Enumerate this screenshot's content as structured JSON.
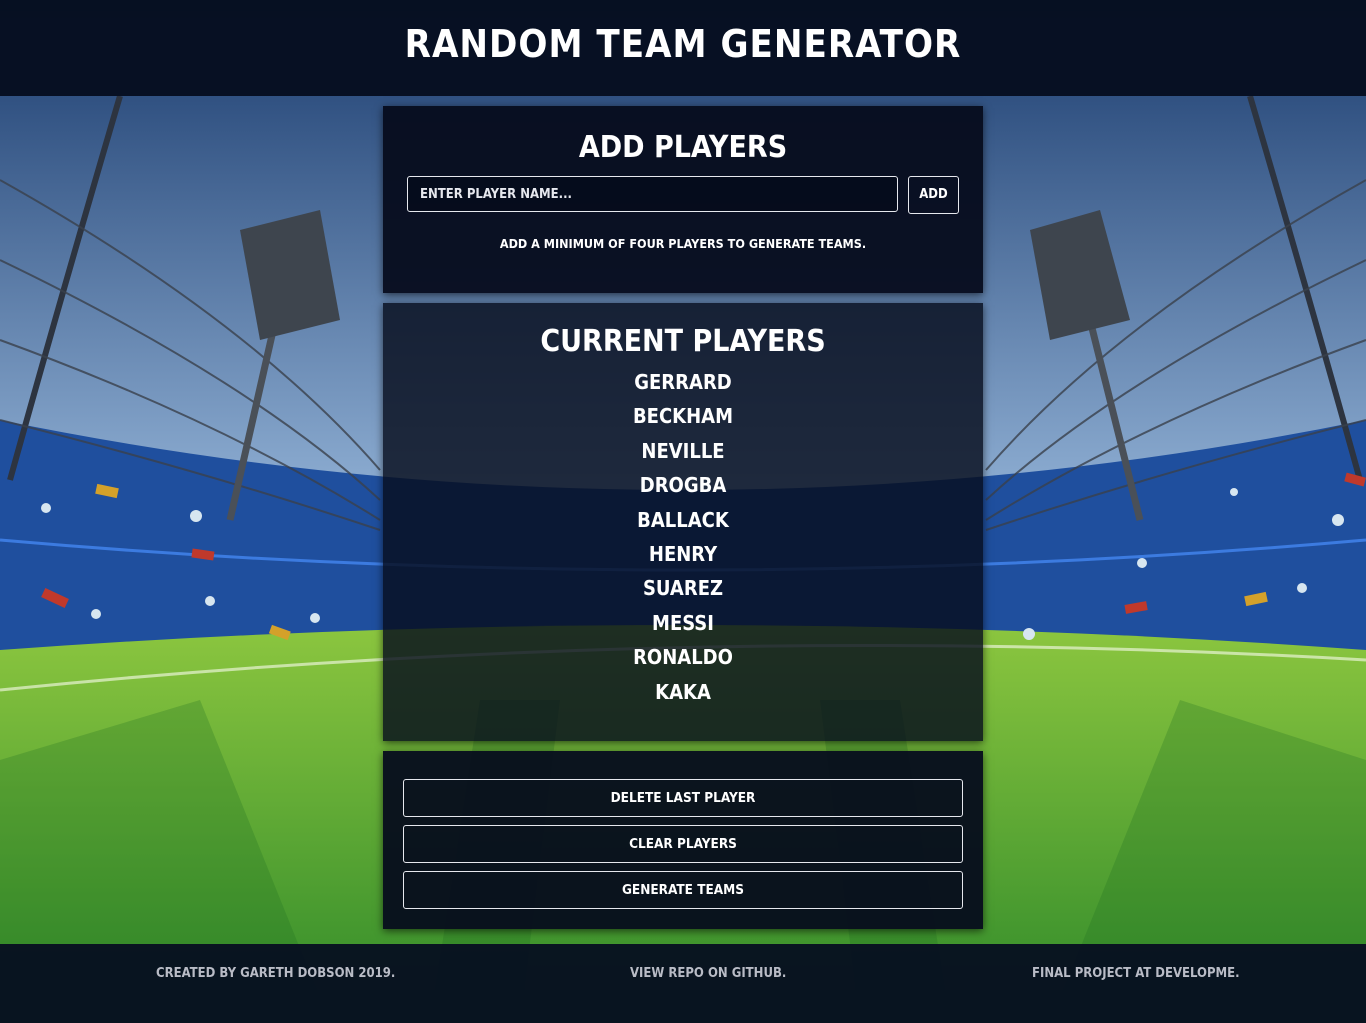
{
  "header": {
    "title": "RANDOM TEAM GENERATOR"
  },
  "add_panel": {
    "title": "ADD PLAYERS",
    "input_placeholder": "ENTER PLAYER NAME...",
    "add_label": "ADD",
    "hint": "ADD A MINIMUM OF FOUR PLAYERS TO GENERATE TEAMS."
  },
  "current_panel": {
    "title": "CURRENT PLAYERS",
    "players": [
      "GERRARD",
      "BECKHAM",
      "NEVILLE",
      "DROGBA",
      "BALLACK",
      "HENRY",
      "SUAREZ",
      "MESSI",
      "RONALDO",
      "KAKA"
    ]
  },
  "actions": {
    "delete_last": "DELETE LAST PLAYER",
    "clear": "CLEAR PLAYERS",
    "generate": "GENERATE TEAMS"
  },
  "footer": {
    "credit": "CREATED BY GARETH DOBSON 2019.",
    "repo": "VIEW REPO ON GITHUB.",
    "project": "FINAL PROJECT AT DEVELOPME."
  },
  "colors": {
    "panel": "#060c1c",
    "header": "#060e20",
    "text": "#ffffff",
    "pitch": "#4fa83a",
    "stands": "#1f4f9e",
    "sky": "#8fb2d8"
  }
}
